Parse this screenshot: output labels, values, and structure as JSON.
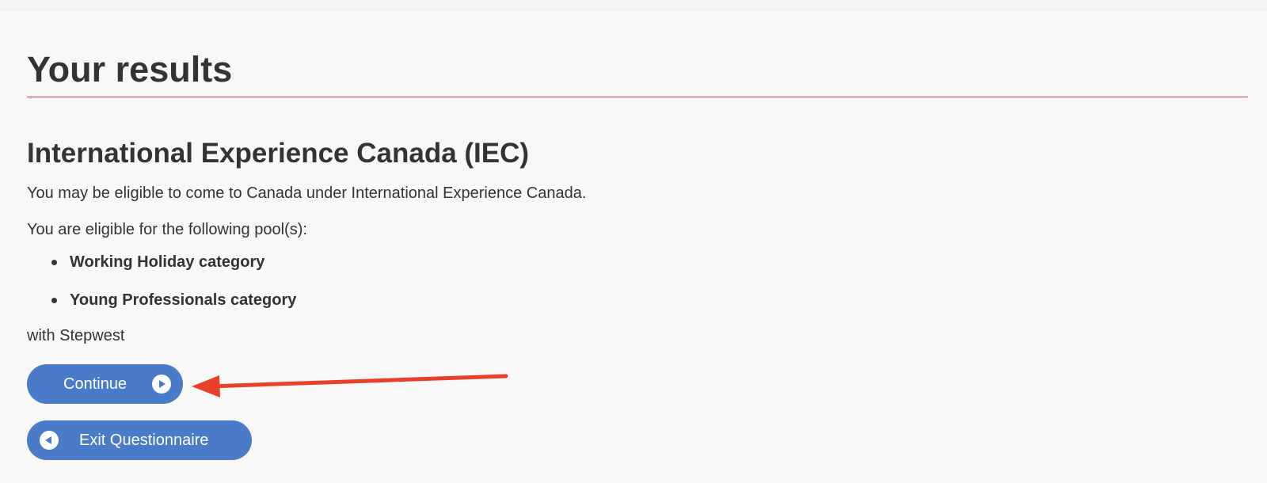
{
  "page": {
    "title": "Your results"
  },
  "result": {
    "program_heading": "International Experience Canada (IEC)",
    "eligible_text": "You may be eligible to come to Canada under International Experience Canada.",
    "pools_intro": "You are eligible for the following pool(s):",
    "pools": [
      {
        "label": "Working Holiday category"
      },
      {
        "label": "Young Professionals category"
      }
    ],
    "with_text": "with Stepwest"
  },
  "actions": {
    "continue_label": "Continue",
    "continue_icon": "play-circle-icon",
    "exit_label": "Exit Questionnaire",
    "exit_icon": "back-circle-icon"
  },
  "colors": {
    "accent_rule": "#d3393b",
    "button_bg": "#4a7bc8",
    "annotation_arrow": "#e8402b",
    "text": "#333333",
    "background": "#f8f8f8"
  }
}
